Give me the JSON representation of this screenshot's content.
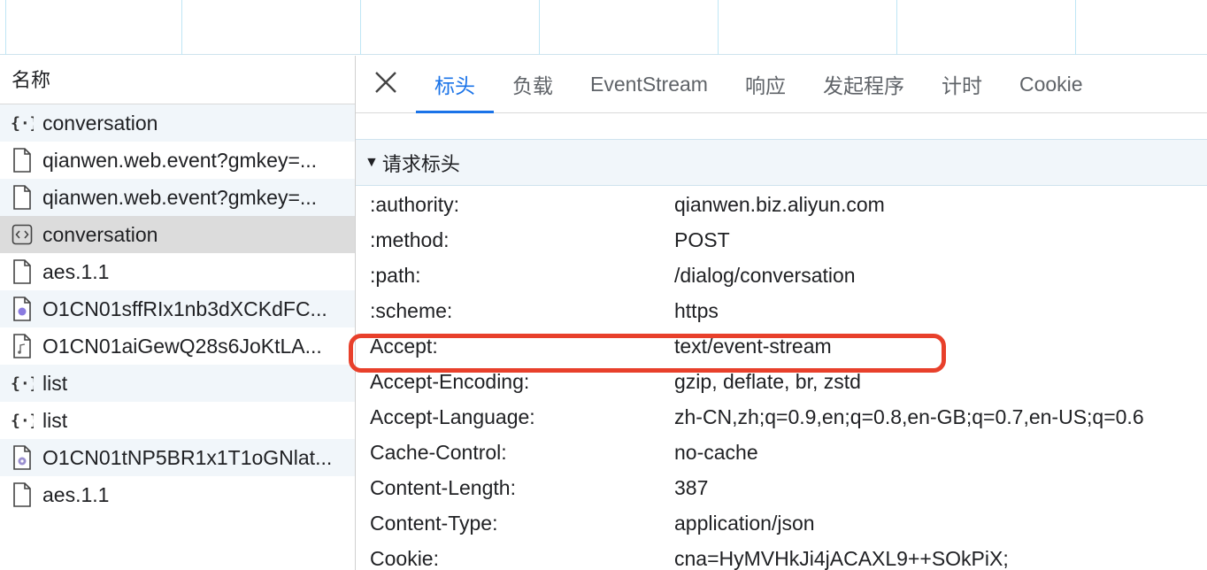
{
  "left_panel": {
    "header": "名称",
    "requests": [
      {
        "name": "conversation",
        "icon": "fetch-braces-icon"
      },
      {
        "name": "qianwen.web.event?gmkey=...",
        "icon": "document-icon"
      },
      {
        "name": "qianwen.web.event?gmkey=...",
        "icon": "document-icon"
      },
      {
        "name": "conversation",
        "icon": "code-tag-icon"
      },
      {
        "name": "aes.1.1",
        "icon": "document-icon"
      },
      {
        "name": "O1CN01sffRIx1nb3dXCKdFC...",
        "icon": "image-file-icon"
      },
      {
        "name": "O1CN01aiGewQ28s6JoKtLA...",
        "icon": "audio-file-icon"
      },
      {
        "name": "list",
        "icon": "fetch-braces-icon"
      },
      {
        "name": "list",
        "icon": "fetch-braces-icon"
      },
      {
        "name": "O1CN01tNP5BR1x1T1oGNlat...",
        "icon": "media-file-icon"
      },
      {
        "name": "aes.1.1",
        "icon": "document-icon"
      }
    ]
  },
  "tabs": [
    "标头",
    "负载",
    "EventStream",
    "响应",
    "发起程序",
    "计时",
    "Cookie"
  ],
  "active_tab": "标头",
  "section": {
    "toggle": "▼",
    "title": "请求标头"
  },
  "headers": [
    {
      "name": ":authority:",
      "value": "qianwen.biz.aliyun.com"
    },
    {
      "name": ":method:",
      "value": "POST"
    },
    {
      "name": ":path:",
      "value": "/dialog/conversation"
    },
    {
      "name": ":scheme:",
      "value": "https"
    },
    {
      "name": "Accept:",
      "value": "text/event-stream"
    },
    {
      "name": "Accept-Encoding:",
      "value": "gzip, deflate, br, zstd"
    },
    {
      "name": "Accept-Language:",
      "value": "zh-CN,zh;q=0.9,en;q=0.8,en-GB;q=0.7,en-US;q=0.6"
    },
    {
      "name": "Cache-Control:",
      "value": "no-cache"
    },
    {
      "name": "Content-Length:",
      "value": "387"
    },
    {
      "name": "Content-Type:",
      "value": "application/json"
    },
    {
      "name": "Cookie:",
      "value": "cna=HyMVHkJi4jACAXL9++SOkPiX;"
    }
  ],
  "colors": {
    "accent": "#1a73e8",
    "highlight": "#e8402b",
    "selected_row": "#dcdcdc",
    "alt_row": "#f1f6fa"
  }
}
